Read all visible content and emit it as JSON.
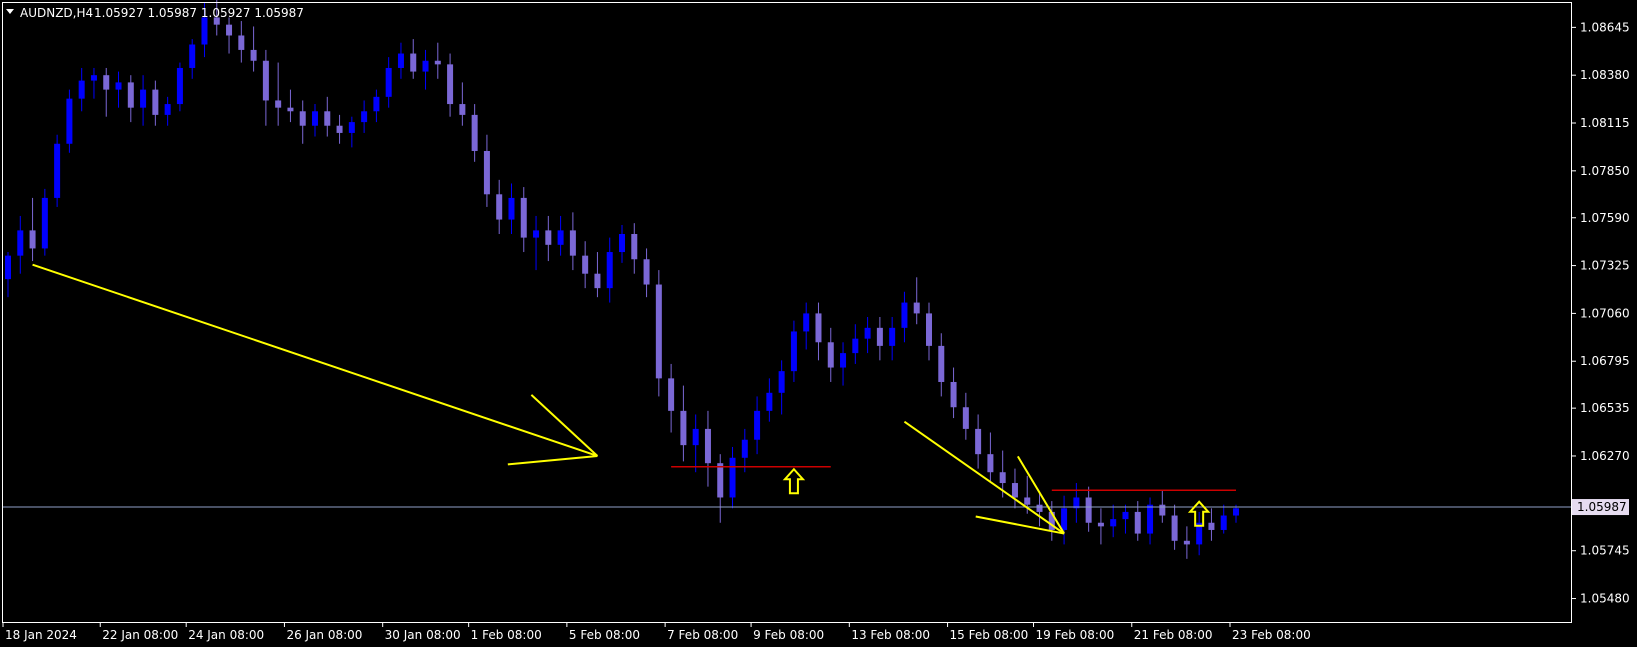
{
  "header": {
    "symbol": "AUDNZD,H4",
    "ohlc": "1.05927 1.05987 1.05927 1.05987"
  },
  "colors": {
    "background": "#000000",
    "frame": "#ffffff",
    "bull_candle": "#0000ff",
    "bear_candle": "#7b68d6",
    "current_price_line": "#8fa0c8",
    "current_price_label_bg": "#e6dcf0",
    "trend_arrow": "#ffff00",
    "level_line": "#cc0000"
  },
  "chart_data": {
    "type": "candlestick",
    "symbol": "AUDNZD",
    "timeframe": "H4",
    "ylim": [
      1.0535,
      1.0878
    ],
    "y_ticks": [
      "1.08645",
      "1.08380",
      "1.08115",
      "1.07850",
      "1.07590",
      "1.07325",
      "1.07060",
      "1.06795",
      "1.06535",
      "1.06270",
      "1.05987",
      "1.05745",
      "1.05480"
    ],
    "x_ticks": [
      "18 Jan 2024",
      "22 Jan 08:00",
      "24 Jan 08:00",
      "26 Jan 08:00",
      "30 Jan 08:00",
      "1 Feb 08:00",
      "5 Feb 08:00",
      "7 Feb 08:00",
      "9 Feb 08:00",
      "13 Feb 08:00",
      "15 Feb 08:00",
      "19 Feb 08:00",
      "21 Feb 08:00",
      "23 Feb 08:00"
    ],
    "current_price": 1.05987,
    "current_price_label": "1.05987",
    "trend_arrows": [
      {
        "from": [
          2,
          1.0733
        ],
        "to": [
          48,
          1.0627
        ]
      },
      {
        "from": [
          73,
          1.0646
        ],
        "to": [
          86,
          1.0584
        ]
      }
    ],
    "support_levels": [
      {
        "price": 1.0621,
        "from": 54,
        "to": 67
      },
      {
        "price": 1.0608,
        "from": 85,
        "to": 100
      }
    ],
    "up_markers": [
      {
        "index": 64,
        "price": 1.0613
      },
      {
        "index": 97,
        "price": 1.0595
      }
    ],
    "candles": [
      [
        1.0725,
        1.074,
        1.0715,
        1.0738
      ],
      [
        1.0738,
        1.076,
        1.0728,
        1.0752
      ],
      [
        1.0752,
        1.077,
        1.0735,
        1.0742
      ],
      [
        1.0742,
        1.0775,
        1.0738,
        1.077
      ],
      [
        1.077,
        1.0805,
        1.0765,
        1.08
      ],
      [
        1.08,
        1.083,
        1.0795,
        1.0825
      ],
      [
        1.0825,
        1.0842,
        1.0818,
        1.0835
      ],
      [
        1.0835,
        1.0842,
        1.0825,
        1.0838
      ],
      [
        1.0838,
        1.0842,
        1.0815,
        1.083
      ],
      [
        1.083,
        1.084,
        1.082,
        1.0834
      ],
      [
        1.0834,
        1.0838,
        1.0812,
        1.082
      ],
      [
        1.082,
        1.0838,
        1.081,
        1.083
      ],
      [
        1.083,
        1.0835,
        1.081,
        1.0816
      ],
      [
        1.0816,
        1.0826,
        1.081,
        1.0822
      ],
      [
        1.0822,
        1.0845,
        1.0818,
        1.0842
      ],
      [
        1.0842,
        1.0858,
        1.0836,
        1.0855
      ],
      [
        1.0855,
        1.0878,
        1.0848,
        1.087
      ],
      [
        1.087,
        1.088,
        1.086,
        1.0866
      ],
      [
        1.0866,
        1.087,
        1.085,
        1.086
      ],
      [
        1.086,
        1.0868,
        1.0845,
        1.0852
      ],
      [
        1.0852,
        1.0865,
        1.084,
        1.0846
      ],
      [
        1.0846,
        1.0852,
        1.081,
        1.0824
      ],
      [
        1.0824,
        1.0845,
        1.081,
        1.082
      ],
      [
        1.082,
        1.083,
        1.0812,
        1.0818
      ],
      [
        1.0818,
        1.0824,
        1.08,
        1.081
      ],
      [
        1.081,
        1.0822,
        1.0804,
        1.0818
      ],
      [
        1.0818,
        1.0826,
        1.0804,
        1.081
      ],
      [
        1.081,
        1.0816,
        1.08,
        1.0806
      ],
      [
        1.0806,
        1.0815,
        1.0798,
        1.0812
      ],
      [
        1.0812,
        1.0824,
        1.0806,
        1.0818
      ],
      [
        1.0818,
        1.083,
        1.0812,
        1.0826
      ],
      [
        1.0826,
        1.0848,
        1.082,
        1.0842
      ],
      [
        1.0842,
        1.0856,
        1.0836,
        1.085
      ],
      [
        1.085,
        1.0858,
        1.0836,
        1.084
      ],
      [
        1.084,
        1.0852,
        1.083,
        1.0846
      ],
      [
        1.0846,
        1.0856,
        1.0836,
        1.0844
      ],
      [
        1.0844,
        1.085,
        1.0815,
        1.0822
      ],
      [
        1.0822,
        1.0834,
        1.081,
        1.0816
      ],
      [
        1.0816,
        1.0822,
        1.079,
        1.0796
      ],
      [
        1.0796,
        1.0805,
        1.0765,
        1.0772
      ],
      [
        1.0772,
        1.078,
        1.075,
        1.0758
      ],
      [
        1.0758,
        1.0778,
        1.075,
        1.077
      ],
      [
        1.077,
        1.0776,
        1.074,
        1.0748
      ],
      [
        1.0748,
        1.076,
        1.073,
        1.0752
      ],
      [
        1.0752,
        1.076,
        1.0735,
        1.0744
      ],
      [
        1.0744,
        1.076,
        1.0738,
        1.0752
      ],
      [
        1.0752,
        1.0762,
        1.073,
        1.0738
      ],
      [
        1.0738,
        1.0746,
        1.072,
        1.0728
      ],
      [
        1.0728,
        1.074,
        1.0715,
        1.072
      ],
      [
        1.072,
        1.0748,
        1.0712,
        1.074
      ],
      [
        1.074,
        1.0755,
        1.0734,
        1.075
      ],
      [
        1.075,
        1.0756,
        1.0728,
        1.0736
      ],
      [
        1.0736,
        1.0742,
        1.0715,
        1.0722
      ],
      [
        1.0722,
        1.073,
        1.066,
        1.067
      ],
      [
        1.067,
        1.0678,
        1.064,
        1.0652
      ],
      [
        1.0652,
        1.0666,
        1.0624,
        1.0633
      ],
      [
        1.0633,
        1.065,
        1.0618,
        1.0642
      ],
      [
        1.0642,
        1.0652,
        1.061,
        1.0623
      ],
      [
        1.0623,
        1.0628,
        1.059,
        1.0604
      ],
      [
        1.0604,
        1.0632,
        1.0598,
        1.0626
      ],
      [
        1.0626,
        1.0642,
        1.0618,
        1.0636
      ],
      [
        1.0636,
        1.066,
        1.0628,
        1.0652
      ],
      [
        1.0652,
        1.067,
        1.0646,
        1.0662
      ],
      [
        1.0662,
        1.068,
        1.065,
        1.0674
      ],
      [
        1.0674,
        1.0702,
        1.0668,
        1.0696
      ],
      [
        1.0696,
        1.0712,
        1.0686,
        1.0706
      ],
      [
        1.0706,
        1.0712,
        1.068,
        1.069
      ],
      [
        1.069,
        1.0698,
        1.0668,
        1.0676
      ],
      [
        1.0676,
        1.069,
        1.0666,
        1.0684
      ],
      [
        1.0684,
        1.07,
        1.0678,
        1.0692
      ],
      [
        1.0692,
        1.0704,
        1.0684,
        1.0698
      ],
      [
        1.0698,
        1.0704,
        1.068,
        1.0688
      ],
      [
        1.0688,
        1.0704,
        1.068,
        1.0698
      ],
      [
        1.0698,
        1.0718,
        1.069,
        1.0712
      ],
      [
        1.0712,
        1.0726,
        1.07,
        1.0706
      ],
      [
        1.0706,
        1.0712,
        1.068,
        1.0688
      ],
      [
        1.0688,
        1.0695,
        1.066,
        1.0668
      ],
      [
        1.0668,
        1.0676,
        1.0648,
        1.0654
      ],
      [
        1.0654,
        1.0662,
        1.0636,
        1.0642
      ],
      [
        1.0642,
        1.065,
        1.062,
        1.0628
      ],
      [
        1.0628,
        1.064,
        1.0612,
        1.0618
      ],
      [
        1.0618,
        1.063,
        1.0604,
        1.0612
      ],
      [
        1.0612,
        1.062,
        1.0598,
        1.0604
      ],
      [
        1.0604,
        1.0616,
        1.0595,
        1.06
      ],
      [
        1.06,
        1.0606,
        1.0588,
        1.0596
      ],
      [
        1.0596,
        1.0602,
        1.058,
        1.0586
      ],
      [
        1.0586,
        1.0605,
        1.0578,
        1.0598
      ],
      [
        1.0598,
        1.0612,
        1.059,
        1.0604
      ],
      [
        1.0604,
        1.061,
        1.0585,
        1.059
      ],
      [
        1.059,
        1.0598,
        1.0578,
        1.0588
      ],
      [
        1.0588,
        1.06,
        1.0582,
        1.0592
      ],
      [
        1.0592,
        1.06,
        1.0584,
        1.0596
      ],
      [
        1.0596,
        1.0602,
        1.058,
        1.0584
      ],
      [
        1.0584,
        1.0604,
        1.0578,
        1.06
      ],
      [
        1.06,
        1.0608,
        1.059,
        1.0594
      ],
      [
        1.0594,
        1.06,
        1.0575,
        1.058
      ],
      [
        1.058,
        1.0588,
        1.057,
        1.0578
      ],
      [
        1.0578,
        1.0596,
        1.0572,
        1.059
      ],
      [
        1.059,
        1.0598,
        1.058,
        1.0586
      ],
      [
        1.0586,
        1.06,
        1.0584,
        1.0594
      ],
      [
        1.0594,
        1.06,
        1.059,
        1.0598
      ]
    ]
  }
}
